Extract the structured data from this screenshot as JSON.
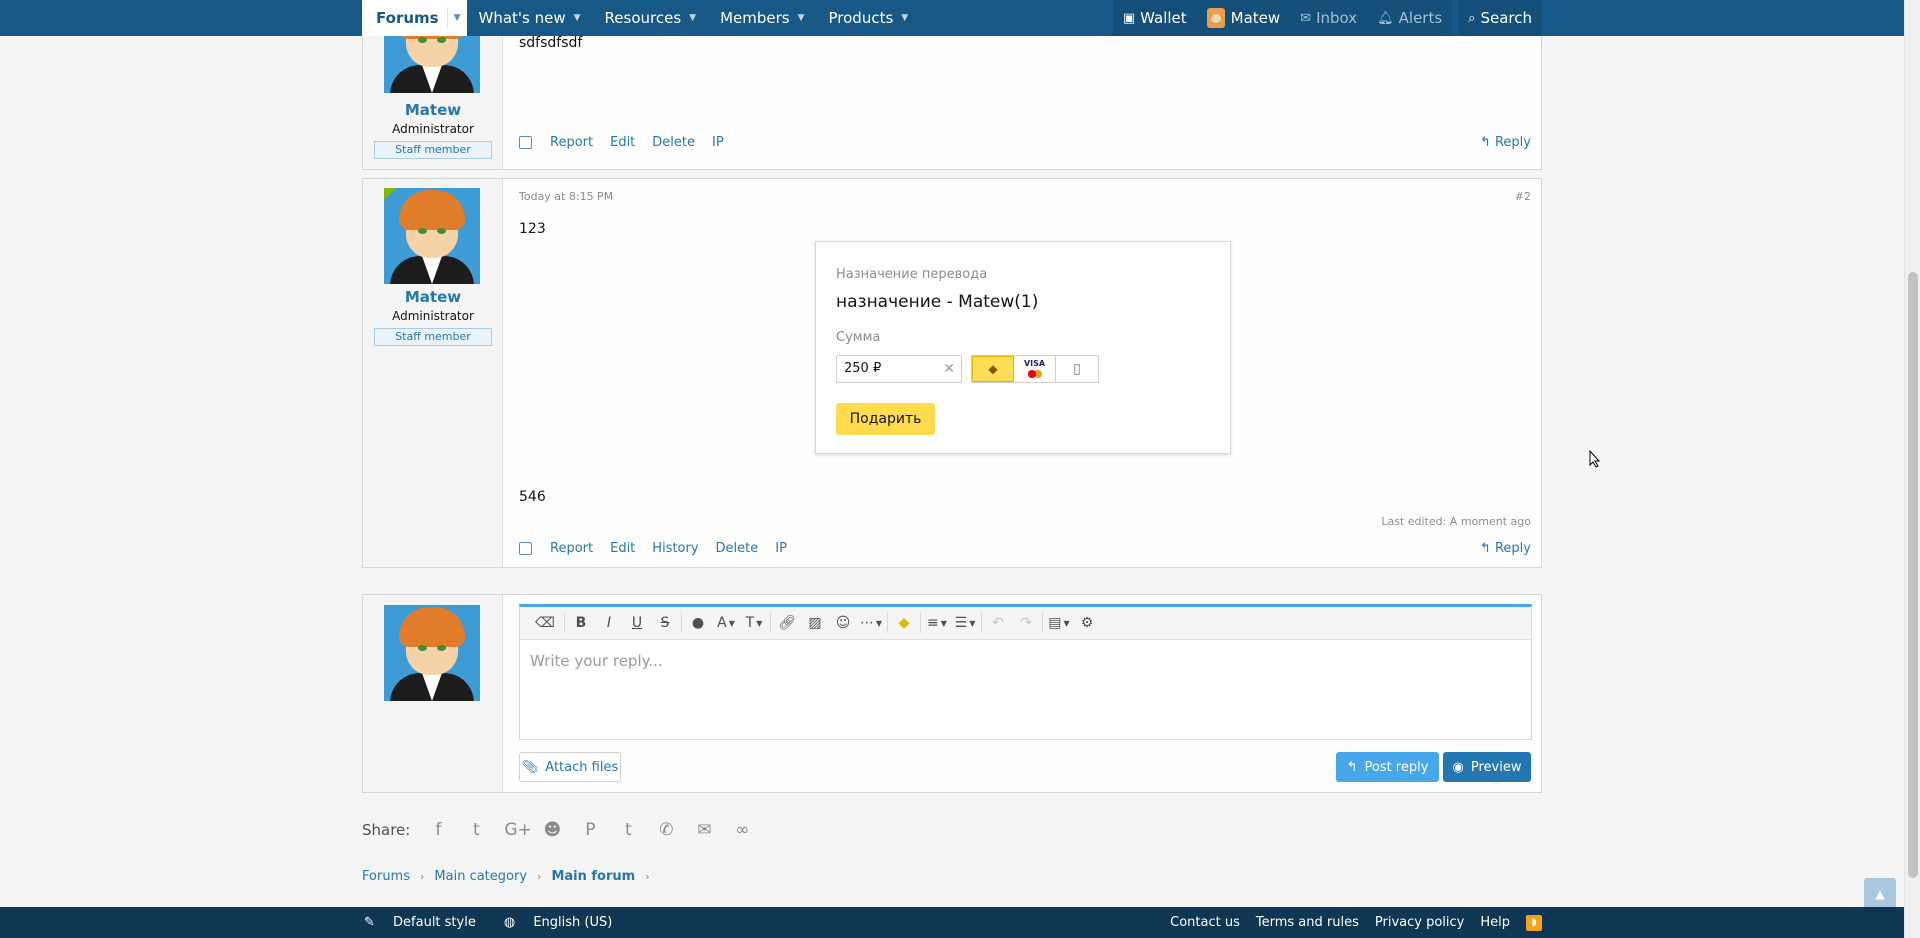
{
  "nav": {
    "tabs": [
      {
        "label": "Forums"
      },
      {
        "label": "What's new"
      },
      {
        "label": "Resources"
      },
      {
        "label": "Members"
      },
      {
        "label": "Products"
      }
    ],
    "right": {
      "wallet": "Wallet",
      "user": "Matew",
      "inbox": "Inbox",
      "alerts": "Alerts",
      "search": "Search"
    }
  },
  "post1": {
    "username": "Matew",
    "user_title": "Administrator",
    "banner": "Staff member",
    "text": "sdfsdfsdf",
    "actions": [
      "Report",
      "Edit",
      "Delete",
      "IP"
    ],
    "reply": "Reply"
  },
  "post2": {
    "username": "Matew",
    "user_title": "Administrator",
    "banner": "Staff member",
    "date": "Today at 8:15 PM",
    "number": "#2",
    "text_top": "123",
    "text_bottom": "546",
    "last_edited": "Last edited: A moment ago",
    "actions": [
      "Report",
      "Edit",
      "History",
      "Delete",
      "IP"
    ],
    "reply": "Reply",
    "donate": {
      "purpose_label": "Назначение перевода",
      "purpose_value": "назначение - Matew(1)",
      "amount_label": "Сумма",
      "amount_value": "250 ₽",
      "card_label": "VISA",
      "button": "Подарить"
    }
  },
  "reply_box": {
    "placeholder": "Write your reply...",
    "attach": "Attach files",
    "post_reply": "Post reply",
    "preview": "Preview"
  },
  "share": {
    "label": "Share:",
    "icons": [
      "facebook-icon",
      "twitter-icon",
      "google-plus-icon",
      "reddit-icon",
      "pinterest-icon",
      "tumblr-icon",
      "whatsapp-icon",
      "email-icon",
      "link-icon"
    ]
  },
  "breadcrumb": [
    "Forums",
    "Main category",
    "Main forum"
  ],
  "footer": {
    "style": "Default style",
    "language": "English (US)",
    "links": [
      "Contact us",
      "Terms and rules",
      "Privacy policy",
      "Help"
    ]
  },
  "colors": {
    "nav_bg": "#185886",
    "link": "#2577b1",
    "footer_bg": "#0f3652",
    "donate_button": "#ffdb4d"
  }
}
